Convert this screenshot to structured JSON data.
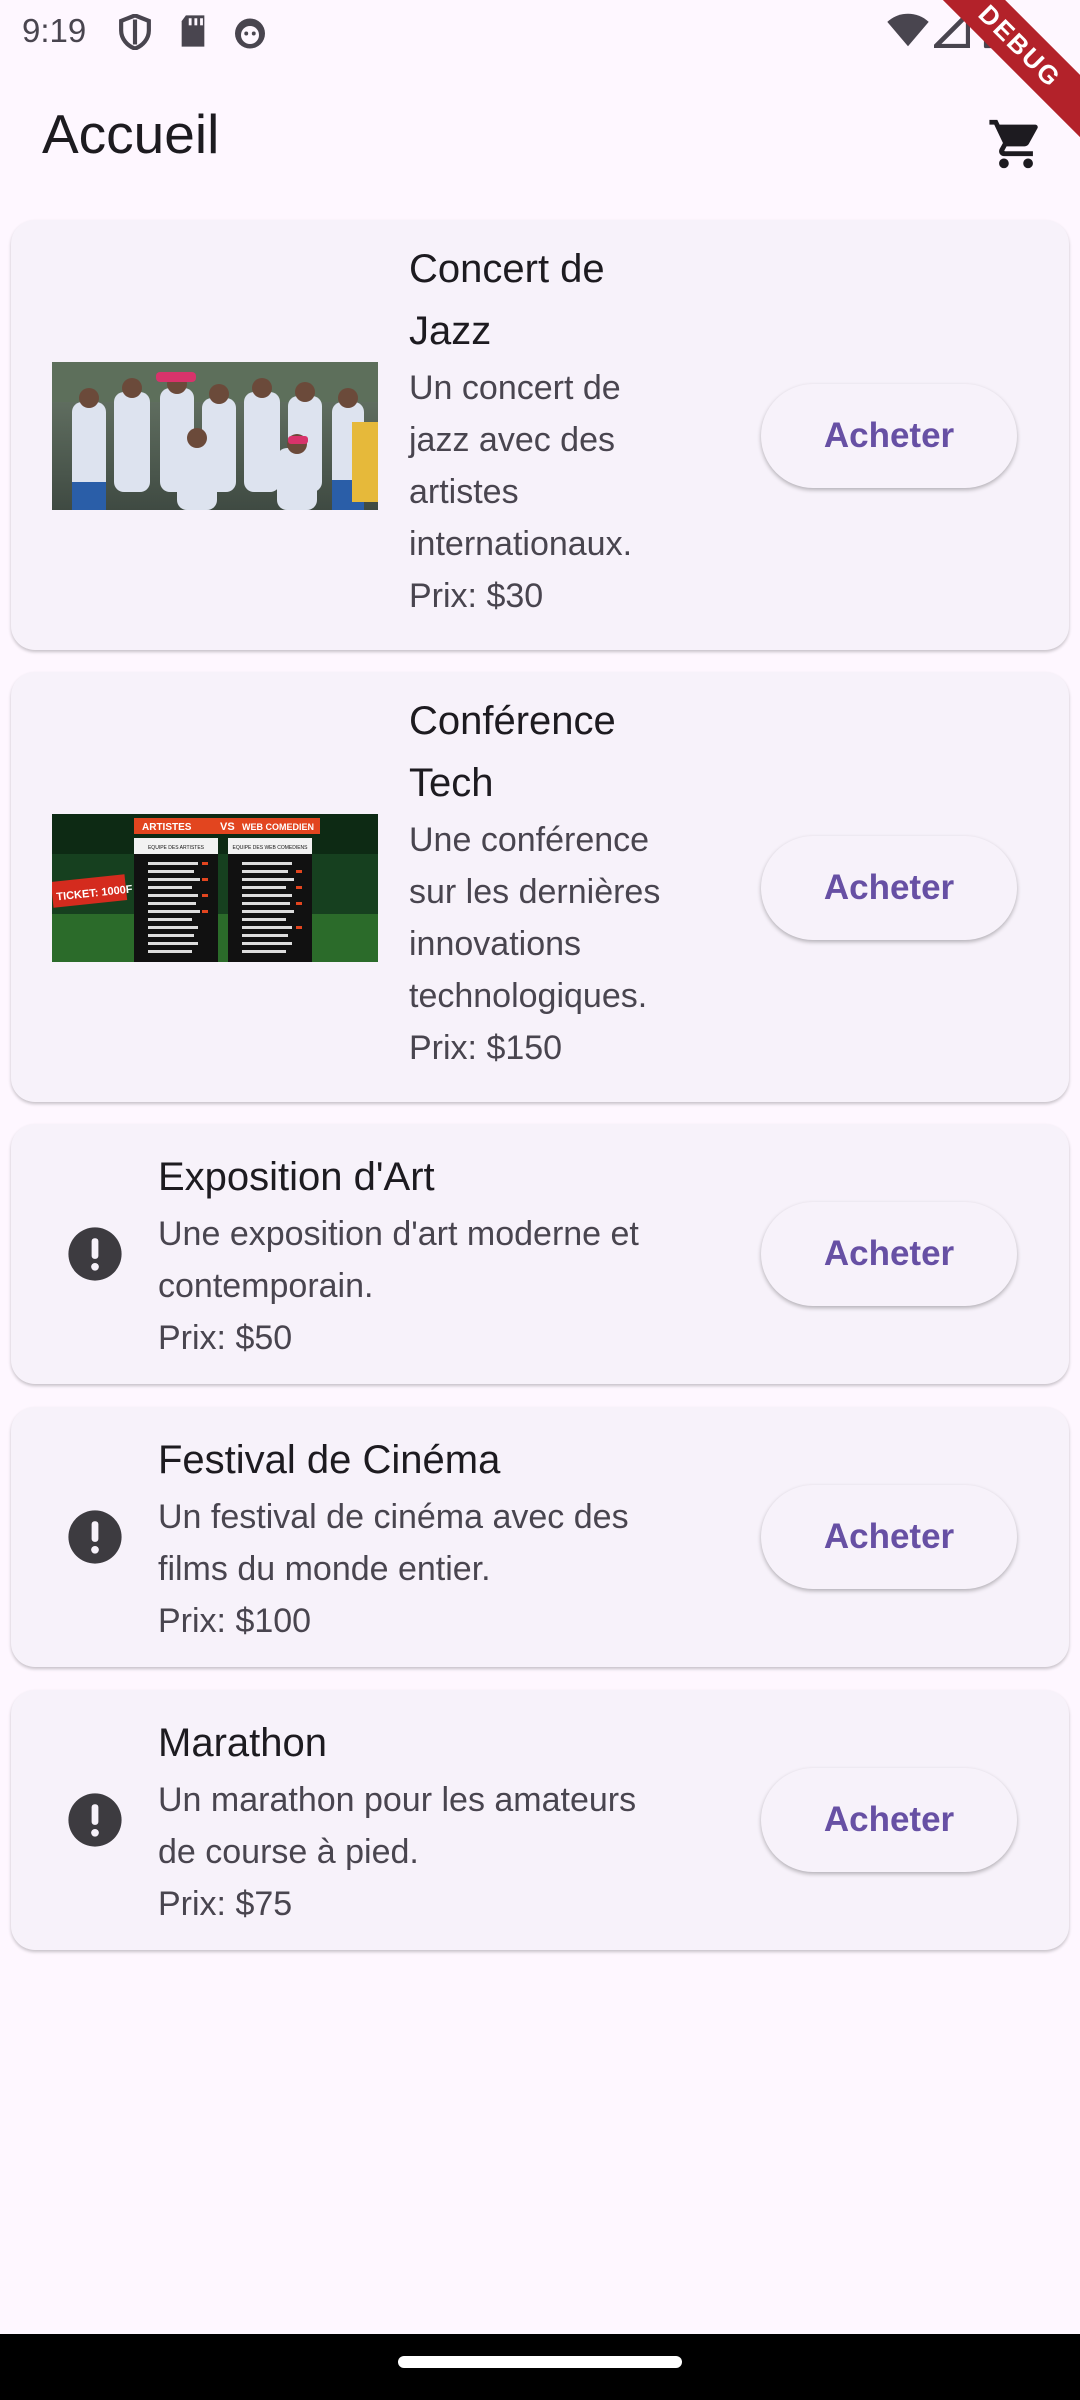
{
  "status_bar": {
    "time": "9:19",
    "debug_label": "DEBUG",
    "icons": [
      "shield-icon",
      "sd-card-icon",
      "face-icon",
      "wifi-icon",
      "signal-icon",
      "battery-icon"
    ]
  },
  "app_bar": {
    "title": "Accueil",
    "cart_icon": "shopping-cart-icon"
  },
  "events": [
    {
      "title_lines": [
        "Concert de",
        "Jazz"
      ],
      "description_lines": [
        "Un concert de",
        "jazz avec des",
        "artistes",
        "internationaux."
      ],
      "price": "Prix: $30",
      "image": "jazz-concert-photo",
      "buy_label": "Acheter"
    },
    {
      "title_lines": [
        "Conférence",
        "Tech"
      ],
      "description_lines": [
        "Une conférence",
        "sur les dernières",
        "innovations",
        "technologiques."
      ],
      "price": "Prix: $150",
      "image": "tech-conference-poster",
      "poster_texts": [
        "ARTISTES",
        "VS",
        "WEB COMEDIEN",
        "EQUIPE DES ARTISTES",
        "EQUIPE DES WEB COMEDIENS",
        "TICKET: 1000F"
      ],
      "buy_label": "Acheter"
    },
    {
      "title_lines": [
        "Exposition d'Art"
      ],
      "description_lines": [
        "Une exposition d'art moderne et",
        "contemporain."
      ],
      "price": "Prix: $50",
      "image": "alert-icon",
      "buy_label": "Acheter"
    },
    {
      "title_lines": [
        "Festival de Cinéma"
      ],
      "description_lines": [
        "Un festival de cinéma avec des",
        "films du monde entier."
      ],
      "price": "Prix: $100",
      "image": "alert-icon",
      "buy_label": "Acheter"
    },
    {
      "title_lines": [
        "Marathon"
      ],
      "description_lines": [
        "Un marathon pour les amateurs",
        "de course à pied."
      ],
      "price": "Prix: $75",
      "image": "alert-icon",
      "buy_label": "Acheter"
    }
  ],
  "colors": {
    "background": "#fef7ff",
    "card": "#f7f2fa",
    "primary": "#6750a4",
    "debug_banner": "#b3222a"
  }
}
